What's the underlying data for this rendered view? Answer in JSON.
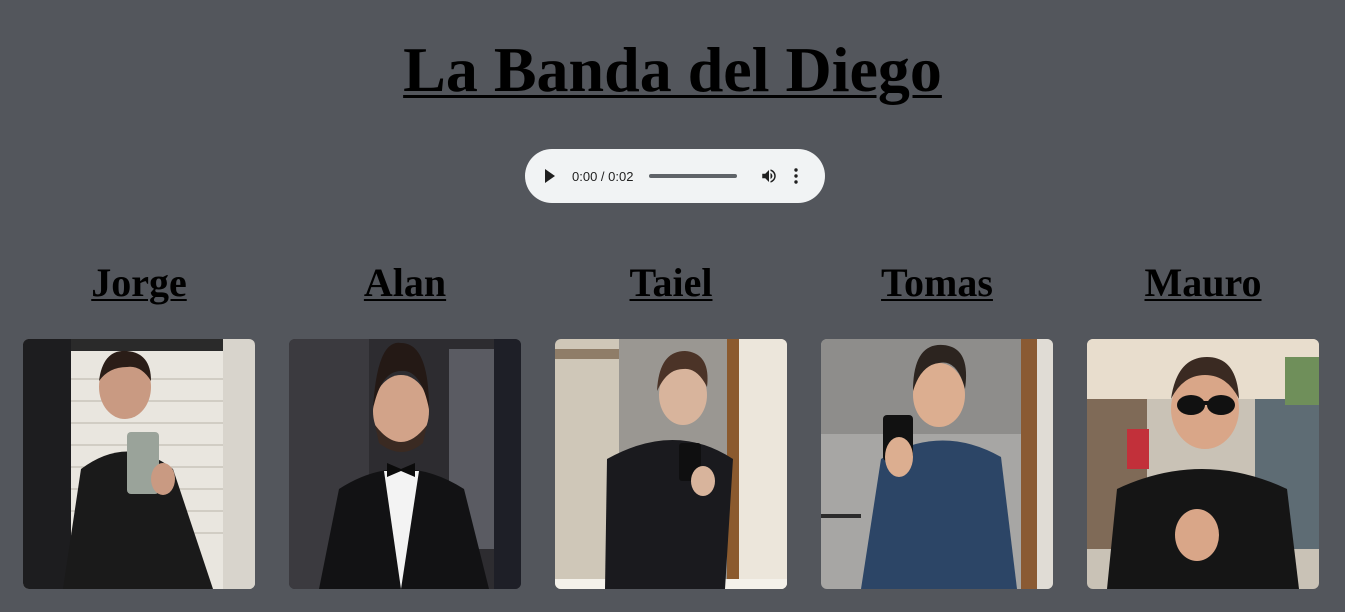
{
  "page": {
    "title": "La Banda del Diego",
    "background": "#53565c"
  },
  "audio": {
    "time": "0:00 / 0:02",
    "progress": 0,
    "play_icon": "play-icon",
    "volume_icon": "volume-icon",
    "more_icon": "more-vertical-icon"
  },
  "members": [
    {
      "name": "Jorge",
      "photo": "selfie of Jorge in black leather jacket with phone in tiled bathroom"
    },
    {
      "name": "Alan",
      "photo": "Alan in black tuxedo with bow tie"
    },
    {
      "name": "Taiel",
      "photo": "mirror selfie of Taiel in black patterned shirt"
    },
    {
      "name": "Tomas",
      "photo": "mirror selfie of Tomas in blue button shirt"
    },
    {
      "name": "Mauro",
      "photo": "Mauro in sunglasses and black t-shirt outdoors"
    }
  ]
}
